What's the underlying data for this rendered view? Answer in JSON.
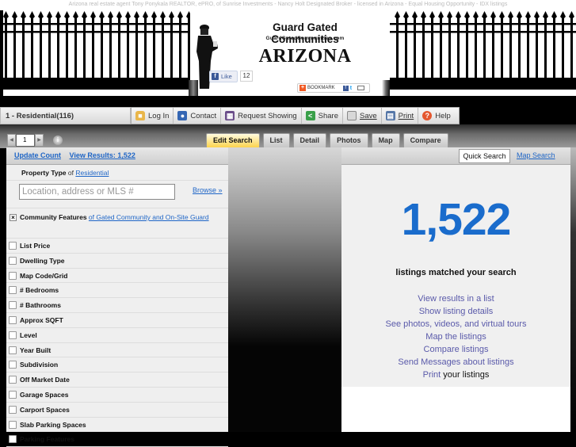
{
  "top_disclaimer": "Arizona real estate agent Tony Ponykala REALTOR, ePRO, of Sunrise Investments - Nancy Holt Designated Broker - licensed in Arizona - Equal Housing Opportunity - IDX listings",
  "banner": {
    "title": "Guard Gated Communities",
    "domain": "GuardGatedCommunities.com",
    "state": "ARIZONA",
    "like_label": "Like",
    "like_count": "12",
    "bookmark_label": "BOOKMARK"
  },
  "toolbar": {
    "property_class": "1 - Residential(116)",
    "buttons": [
      {
        "label": "Log In",
        "icon": "lock-icon"
      },
      {
        "label": "Contact",
        "icon": "person-icon"
      },
      {
        "label": "Request Showing",
        "icon": "calendar-icon"
      },
      {
        "label": "Share",
        "icon": "share-icon"
      },
      {
        "label": "Save",
        "icon": "save-icon"
      },
      {
        "label": "Print",
        "icon": "printer-icon"
      },
      {
        "label": "Help",
        "icon": "help-icon"
      }
    ]
  },
  "pager": {
    "page": "1"
  },
  "view_tabs": [
    {
      "label": "Edit Search",
      "active": true
    },
    {
      "label": "List",
      "active": false
    },
    {
      "label": "Detail",
      "active": false
    },
    {
      "label": "Photos",
      "active": false
    },
    {
      "label": "Map",
      "active": false
    },
    {
      "label": "Compare",
      "active": false
    }
  ],
  "search_panel": {
    "update_count": "Update Count",
    "view_results": "View Results: 1,522",
    "property_type_label": "Property Type",
    "of": "of",
    "property_type_value": "Residential",
    "location_placeholder": "Location, address or MLS #",
    "browse": "Browse »",
    "community_features_label": "Community Features",
    "community_features_value": "of Gated Community and On-Site Guard",
    "criteria": [
      "List Price",
      "Dwelling Type",
      "Map Code/Grid",
      "# Bedrooms",
      "# Bathrooms",
      "Approx SQFT",
      "Level",
      "Year Built",
      "Subdivision",
      "Off Market Date",
      "Garage Spaces",
      "Carport Spaces",
      "Slab Parking Spaces",
      "Parking Features"
    ]
  },
  "results_panel": {
    "quick_search": "Quick Search",
    "map_search": "Map Search",
    "count": "1,522",
    "matched_text": "listings matched your search",
    "actions": [
      {
        "link": "View results in a list",
        "rest": ""
      },
      {
        "link": "Show listing details",
        "rest": ""
      },
      {
        "link": "See photos, videos, and virtual tours",
        "rest": ""
      },
      {
        "link": "Map the listings",
        "rest": ""
      },
      {
        "link": "Compare listings",
        "rest": ""
      },
      {
        "link": "Send Messages about listings",
        "rest": ""
      },
      {
        "link": "Print",
        "rest": " your listings"
      }
    ]
  },
  "colors": {
    "link_blue": "#1f66c7",
    "count_blue": "#1a6ccc",
    "action_purple": "#5a5aaa",
    "active_tab": "#fcd34d"
  }
}
